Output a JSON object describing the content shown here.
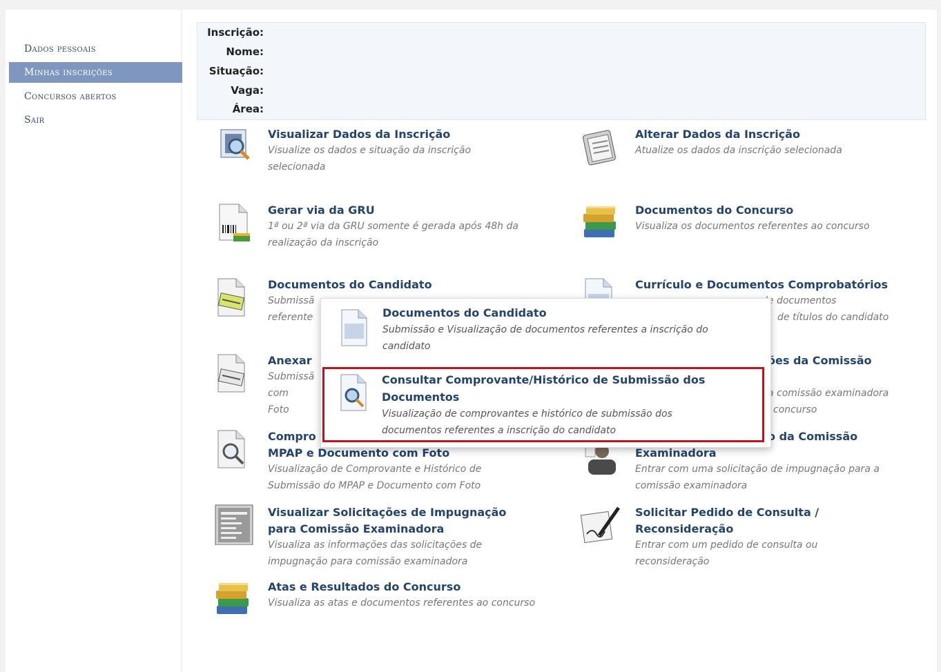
{
  "sidebar": {
    "items": [
      {
        "label": "Dados pessoais",
        "active": false
      },
      {
        "label": "Minhas inscrições",
        "active": true
      },
      {
        "label": "Concursos abertos",
        "active": false
      },
      {
        "label": "Sair",
        "active": false
      }
    ]
  },
  "info": {
    "inscricao": "Inscrição:",
    "nome": "Nome:",
    "situacao": "Situação:",
    "vaga": "Vaga:",
    "area": "Área:"
  },
  "actions": [
    {
      "title": "Visualizar Dados da Inscrição",
      "desc": "Visualize os dados e situação da inscrição selecionada",
      "icon": "view-inscription-icon"
    },
    {
      "title": "Alterar Dados da Inscrição",
      "desc": "Atualize os dados da inscrição selecionada",
      "icon": "edit-document-icon"
    },
    {
      "title": "Gerar via da GRU",
      "desc": "1ª ou 2ª via da GRU somente é gerada após 48h da realização da inscrição",
      "icon": "barcode-document-icon"
    },
    {
      "title": "Documentos do Concurso",
      "desc": "Visualiza os documentos referentes ao concurso",
      "icon": "books-icon"
    },
    {
      "title": "Documentos do Candidato",
      "desc_visible": "Submissã",
      "desc2_visible": "referente",
      "icon": "document-pen-icon"
    },
    {
      "title": "Currículo e Documentos Comprobatórios",
      "desc_visible": "o de documentos",
      "desc2_visible": "de títulos do candidato",
      "icon": "document-icon"
    },
    {
      "title": "Anexar",
      "desc_visible": "Submissã",
      "desc2_visible": "com Foto",
      "icon": "attach-document-icon"
    },
    {
      "title_visible": "ões da Comissão",
      "desc_visible": "a comissão examinadora",
      "desc2_visible": "concurso",
      "icon": "commission-icon"
    },
    {
      "title_l1": "Compro",
      "title_l2": "MPAP e Documento com Foto",
      "desc": "Visualização de Comprovante e Histórico de Submissão do MPAP e Documento com Foto",
      "icon": "search-document-icon"
    },
    {
      "title_l1": "o da Comissão",
      "title_l2": "Examinadora",
      "desc": "Entrar com uma solicitação de impugnação para a comissão examinadora",
      "icon": "person-icon"
    },
    {
      "title": "Visualizar Solicitações de Impugnação para Comissão Examinadora",
      "title_l1": "Visualizar Solicitações de Impugnação",
      "title_l2": "para Comissão Examinadora",
      "desc": "Visualiza as informações das solicitações de impugnação para comissão examinadora",
      "icon": "list-document-icon"
    },
    {
      "title_l1": "Solicitar Pedido de Consulta /",
      "title_l2": "Reconsideração",
      "desc": "Entrar com um pedido de consulta ou reconsideração",
      "icon": "signature-icon"
    },
    {
      "title": "Atas e Resultados do Concurso",
      "desc": "Visualiza as atas e documentos referentes ao concurso",
      "icon": "books-icon"
    }
  ],
  "popup": {
    "item1": {
      "title": "Documentos do Candidato",
      "desc": "Submissão e Visualização de documentos referentes a inscrição do candidato"
    },
    "item2": {
      "title_l1": "Consultar Comprovante/Histórico de Submissão dos",
      "title_l2": "Documentos",
      "desc_l1": "Visualização de comprovantes e histórico de submissão dos",
      "desc_l2": "documentos referentes a inscrição do candidato"
    }
  },
  "colors": {
    "accent": "#7f97bf",
    "link": "#23446f",
    "highlight": "#c1121f"
  }
}
